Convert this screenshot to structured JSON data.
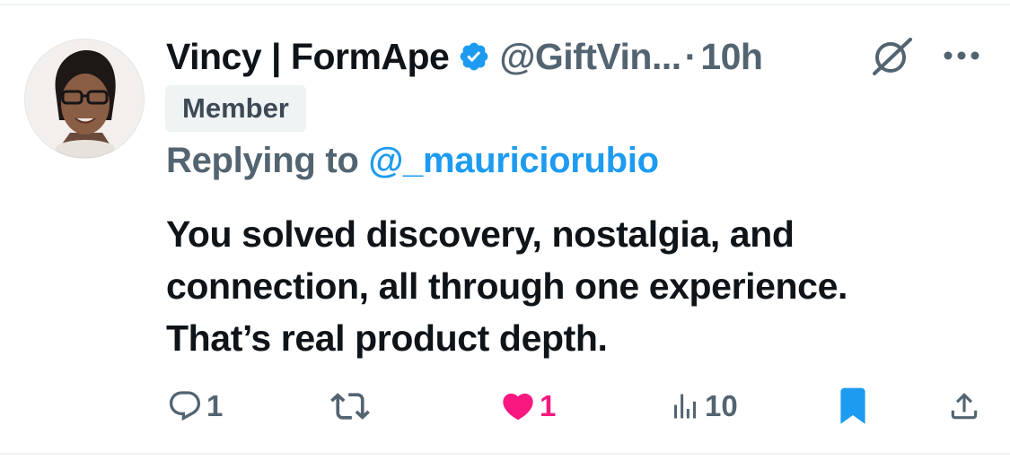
{
  "author": {
    "name": "Vincy | FormApe",
    "handle": "@GiftVin...",
    "separator": "·",
    "time": "10h",
    "badge": "Member",
    "verified_color": "#1d9bf0"
  },
  "reply_context": {
    "prefix": "Replying to",
    "mention": "@_mauriciorubio"
  },
  "tweet": {
    "lines": [
      "You solved discovery, nostalgia, and",
      "connection, all through one experience.",
      "That’s real product depth."
    ]
  },
  "actions": {
    "reply_count": "1",
    "like_count": "1",
    "views_count": "10",
    "like_color": "#f91880",
    "bookmark_color": "#1d9bf0"
  },
  "icons": [
    "grok-icon",
    "more-icon",
    "reply-icon",
    "retweet-icon",
    "heart-icon",
    "views-icon",
    "bookmark-icon",
    "share-icon",
    "verified-icon"
  ]
}
